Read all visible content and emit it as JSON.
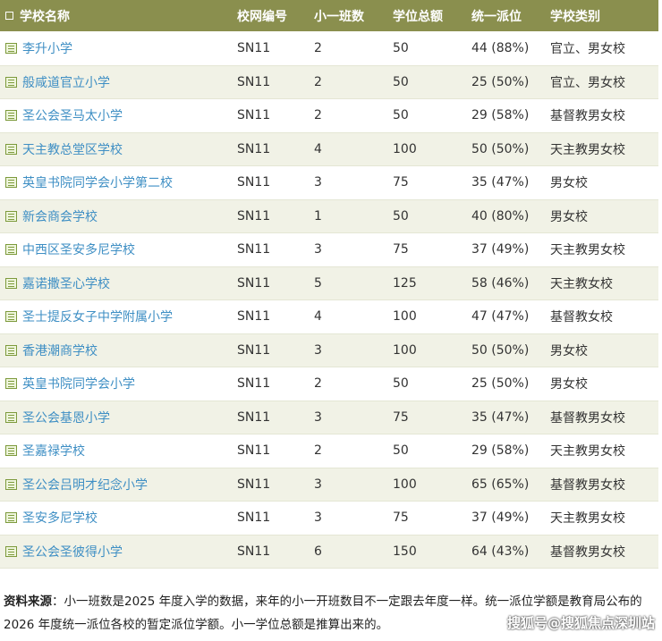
{
  "headers": [
    "学校名称",
    "校网编号",
    "小一班数",
    "学位总额",
    "统一派位",
    "学校类别"
  ],
  "rows": [
    {
      "name": "李升小学",
      "net": "SN11",
      "classes": "2",
      "places": "50",
      "allocation": "44 (88%)",
      "category": "官立、男女校"
    },
    {
      "name": "般咸道官立小学",
      "net": "SN11",
      "classes": "2",
      "places": "50",
      "allocation": "25 (50%)",
      "category": "官立、男女校"
    },
    {
      "name": "圣公会圣马太小学",
      "net": "SN11",
      "classes": "2",
      "places": "50",
      "allocation": "29 (58%)",
      "category": "基督教男女校"
    },
    {
      "name": "天主教总堂区学校",
      "net": "SN11",
      "classes": "4",
      "places": "100",
      "allocation": "50 (50%)",
      "category": "天主教男女校"
    },
    {
      "name": "英皇书院同学会小学第二校",
      "net": "SN11",
      "classes": "3",
      "places": "75",
      "allocation": "35 (47%)",
      "category": "男女校"
    },
    {
      "name": "新会商会学校",
      "net": "SN11",
      "classes": "1",
      "places": "50",
      "allocation": "40 (80%)",
      "category": "男女校"
    },
    {
      "name": "中西区圣安多尼学校",
      "net": "SN11",
      "classes": "3",
      "places": "75",
      "allocation": "37 (49%)",
      "category": "天主教男女校"
    },
    {
      "name": "嘉诺撒圣心学校",
      "net": "SN11",
      "classes": "5",
      "places": "125",
      "allocation": "58 (46%)",
      "category": "天主教女校"
    },
    {
      "name": "圣士提反女子中学附属小学",
      "net": "SN11",
      "classes": "4",
      "places": "100",
      "allocation": "47 (47%)",
      "category": "基督教女校"
    },
    {
      "name": "香港潮商学校",
      "net": "SN11",
      "classes": "3",
      "places": "100",
      "allocation": "50 (50%)",
      "category": "男女校"
    },
    {
      "name": "英皇书院同学会小学",
      "net": "SN11",
      "classes": "2",
      "places": "50",
      "allocation": "25 (50%)",
      "category": "男女校"
    },
    {
      "name": "圣公会基恩小学",
      "net": "SN11",
      "classes": "3",
      "places": "75",
      "allocation": "35 (47%)",
      "category": "基督教男女校"
    },
    {
      "name": "圣嘉禄学校",
      "net": "SN11",
      "classes": "2",
      "places": "50",
      "allocation": "29 (58%)",
      "category": "天主教男女校"
    },
    {
      "name": "圣公会吕明才纪念小学",
      "net": "SN11",
      "classes": "3",
      "places": "100",
      "allocation": "65 (65%)",
      "category": "基督教男女校"
    },
    {
      "name": "圣安多尼学校",
      "net": "SN11",
      "classes": "3",
      "places": "75",
      "allocation": "37 (49%)",
      "category": "天主教男女校"
    },
    {
      "name": "圣公会圣彼得小学",
      "net": "SN11",
      "classes": "6",
      "places": "150",
      "allocation": "64 (43%)",
      "category": "基督教男女校"
    }
  ],
  "footer": {
    "source_label": "资料来源",
    "source_text": "：小一班数是2025 年度入学的数据，来年的小一开班数目不一定跟去年度一样。统一派位学额是教育局公布的2026 年度统一派位各校的暂定派位学额。小一学位总额是推算出来的。"
  },
  "watermark": "搜狐号@搜狐焦点深圳站",
  "colors": {
    "header_bg": "#8a8f4e",
    "stripe": "#f1f2e6",
    "link": "#3f8fc4"
  }
}
